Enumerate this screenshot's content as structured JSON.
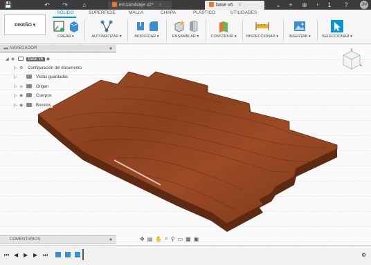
{
  "tabs": [
    {
      "label": "emsamblaje v2*",
      "active": false
    },
    {
      "label": "base v6",
      "active": true
    }
  ],
  "ribbon": {
    "workspace": "DISEÑO ▾",
    "tabs": [
      "SÓLIDO",
      "SUPERFICIE",
      "MALLA",
      "CHAPA",
      "PLÁSTICO",
      "UTILIDADES"
    ],
    "groups": [
      "CREAR ▾",
      "AUTOMATIZAR ▾",
      "MODIFICAR ▾",
      "ENSAMBLAR ▾",
      "CONSTRUIR ▾",
      "INSPECCIONAR ▾",
      "INSERTAR ▾",
      "SELECCIONAR ▾"
    ]
  },
  "user": {
    "avatar": "JM",
    "notifications": "1"
  },
  "browser": {
    "title": "NAVEGADOR",
    "root": "base v6",
    "items": [
      "Configuración del documento",
      "Vistas guardadas",
      "Origen",
      "Cuerpos",
      "Bocetos"
    ]
  },
  "comments": {
    "title": "COMENTARIOS"
  },
  "icons": {
    "accent": "#0696d7",
    "wood": "#8b3f1c"
  }
}
